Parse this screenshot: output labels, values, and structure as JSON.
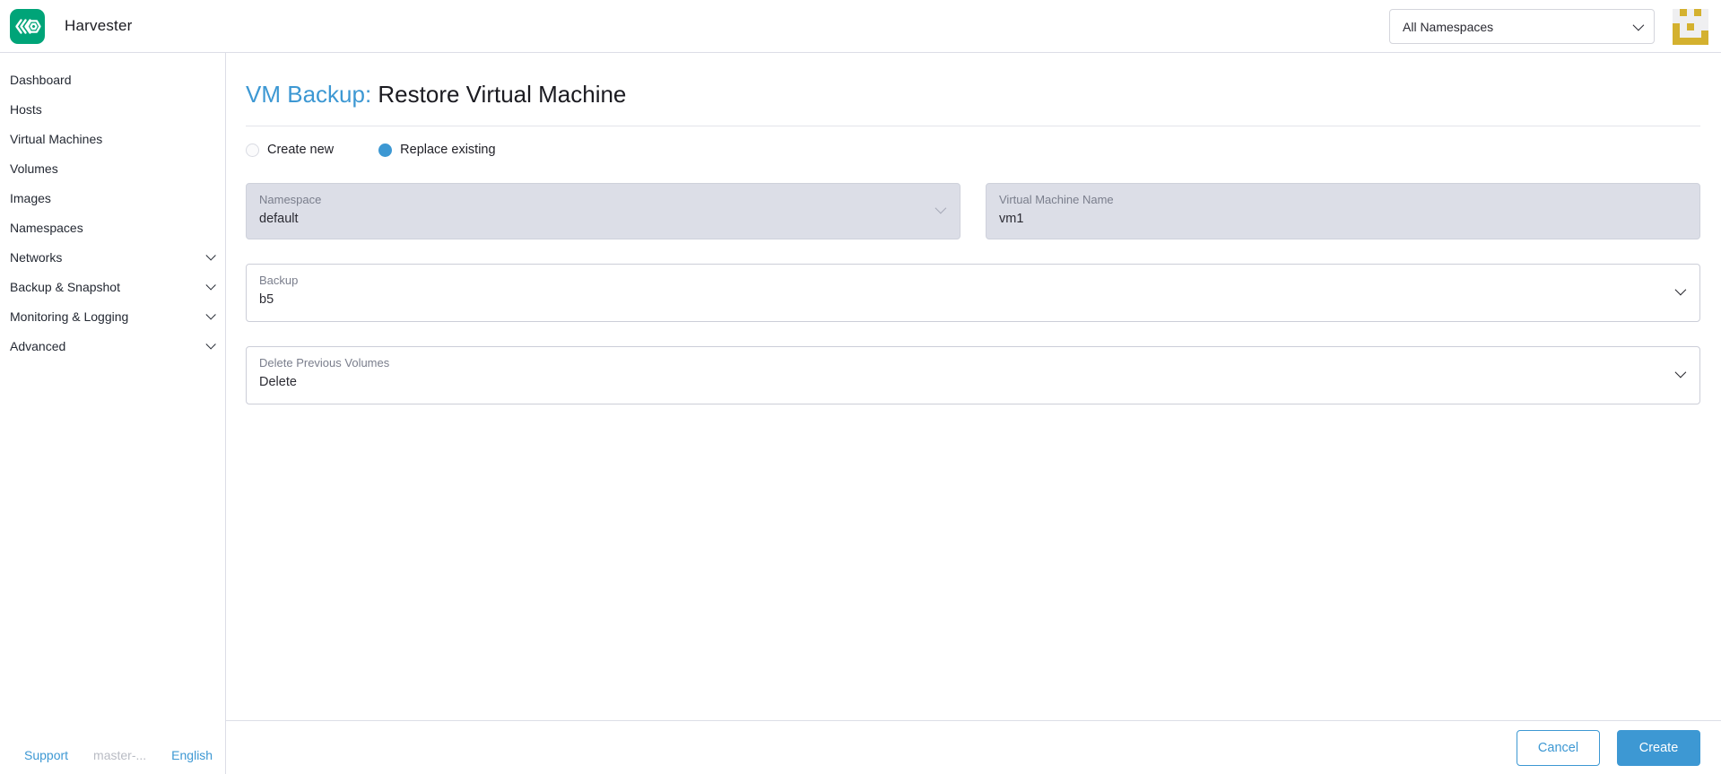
{
  "header": {
    "app_title": "Harvester",
    "namespace_filter": "All Namespaces"
  },
  "sidebar": {
    "items": [
      {
        "label": "Dashboard",
        "expandable": false
      },
      {
        "label": "Hosts",
        "expandable": false
      },
      {
        "label": "Virtual Machines",
        "expandable": false
      },
      {
        "label": "Volumes",
        "expandable": false
      },
      {
        "label": "Images",
        "expandable": false
      },
      {
        "label": "Namespaces",
        "expandable": false
      },
      {
        "label": "Networks",
        "expandable": true
      },
      {
        "label": "Backup & Snapshot",
        "expandable": true
      },
      {
        "label": "Monitoring & Logging",
        "expandable": true
      },
      {
        "label": "Advanced",
        "expandable": true
      }
    ],
    "footer": {
      "support": "Support",
      "version": "master-...",
      "language": "English"
    }
  },
  "main": {
    "title_prefix": "VM Backup:",
    "title": "Restore Virtual Machine",
    "restore_mode": {
      "options": [
        {
          "label": "Create new",
          "selected": false
        },
        {
          "label": "Replace existing",
          "selected": true
        }
      ]
    },
    "fields": {
      "namespace": {
        "label": "Namespace",
        "value": "default",
        "disabled": true
      },
      "vm_name": {
        "label": "Virtual Machine Name",
        "value": "vm1",
        "disabled": true
      },
      "backup": {
        "label": "Backup",
        "value": "b5"
      },
      "delete_previous_volumes": {
        "label": "Delete Previous Volumes",
        "value": "Delete"
      }
    },
    "actions": {
      "cancel": "Cancel",
      "create": "Create"
    }
  },
  "colors": {
    "primary_blue": "#3d98d3",
    "brand_green": "#00a478",
    "disabled_field_bg": "#dcdee7",
    "avatar_gold": "#d4b12f"
  }
}
